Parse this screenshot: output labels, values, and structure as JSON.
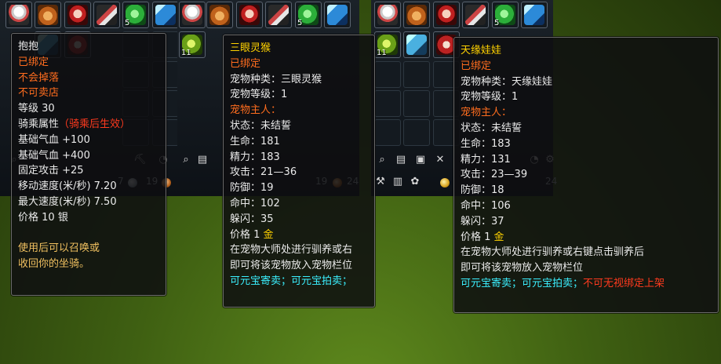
{
  "slot_counts": {
    "jade": "5",
    "leaf": "11"
  },
  "toolbar": {
    "silver_amount": "7",
    "copper_amount": "19",
    "copper_amount_2": "24"
  },
  "tooltips": [
    {
      "lines": [
        {
          "parts": [
            {
              "text": "抱抱",
              "color": "white"
            }
          ]
        },
        {
          "parts": [
            {
              "text": "已绑定",
              "color": "orange"
            }
          ]
        },
        {
          "parts": [
            {
              "text": "不会掉落",
              "color": "orange"
            }
          ]
        },
        {
          "parts": [
            {
              "text": "不可卖店",
              "color": "orange"
            }
          ]
        },
        {
          "parts": [
            {
              "text": "等级 30",
              "color": "white"
            }
          ]
        },
        {
          "parts": [
            {
              "text": "骑乘属性",
              "color": "white"
            },
            {
              "text": "（骑乘后生效）",
              "color": "red"
            }
          ]
        },
        {
          "parts": [
            {
              "text": "基础气血 +100",
              "color": "white"
            }
          ]
        },
        {
          "parts": [
            {
              "text": "基础气血 +400",
              "color": "white"
            }
          ]
        },
        {
          "parts": [
            {
              "text": "固定攻击 +25",
              "color": "white"
            }
          ]
        },
        {
          "parts": [
            {
              "text": "移动速度(米/秒) 7.20",
              "color": "white"
            }
          ]
        },
        {
          "parts": [
            {
              "text": "最大速度(米/秒) 7.50",
              "color": "white"
            }
          ]
        },
        {
          "parts": [
            {
              "text": "价格  10 ",
              "color": "white"
            },
            {
              "text": "银",
              "color": "white"
            }
          ]
        },
        {
          "parts": [
            {
              "text": "",
              "color": "white"
            }
          ]
        },
        {
          "parts": [
            {
              "text": "使用后可以召唤或",
              "color": "tan"
            }
          ]
        },
        {
          "parts": [
            {
              "text": "收回你的坐骑。",
              "color": "tan"
            }
          ]
        }
      ]
    },
    {
      "lines": [
        {
          "parts": [
            {
              "text": "三眼灵猴",
              "color": "yellow"
            }
          ]
        },
        {
          "parts": [
            {
              "text": "已绑定",
              "color": "orange"
            }
          ]
        },
        {
          "parts": [
            {
              "text": "宠物种类：三眼灵猴",
              "color": "white"
            }
          ]
        },
        {
          "parts": [
            {
              "text": "宠物等级：1",
              "color": "white"
            }
          ]
        },
        {
          "parts": [
            {
              "text": "宠物主人：",
              "color": "orange"
            }
          ]
        },
        {
          "parts": [
            {
              "text": "状态：未结誓",
              "color": "white"
            }
          ]
        },
        {
          "parts": [
            {
              "text": "生命：181",
              "color": "white"
            }
          ]
        },
        {
          "parts": [
            {
              "text": "精力：183",
              "color": "white"
            }
          ]
        },
        {
          "parts": [
            {
              "text": "攻击：21—36",
              "color": "white"
            }
          ]
        },
        {
          "parts": [
            {
              "text": "防御：19",
              "color": "white"
            }
          ]
        },
        {
          "parts": [
            {
              "text": "命中：102",
              "color": "white"
            }
          ]
        },
        {
          "parts": [
            {
              "text": "躲闪：35",
              "color": "white"
            }
          ]
        },
        {
          "parts": [
            {
              "text": "价格  1 ",
              "color": "white"
            },
            {
              "text": "金",
              "color": "gold"
            }
          ]
        },
        {
          "parts": [
            {
              "text": "在宠物大师处进行驯养或右",
              "color": "white"
            }
          ]
        },
        {
          "parts": [
            {
              "text": "即可将该宠物放入宠物栏位",
              "color": "white"
            }
          ]
        },
        {
          "parts": [
            {
              "text": "可元宝寄卖；可元宝拍卖；",
              "color": "cyan"
            }
          ]
        }
      ]
    },
    {
      "lines": [
        {
          "parts": [
            {
              "text": "天缘娃娃",
              "color": "yellow"
            }
          ]
        },
        {
          "parts": [
            {
              "text": "已绑定",
              "color": "orange"
            }
          ]
        },
        {
          "parts": [
            {
              "text": "宠物种类：天缘娃娃",
              "color": "white"
            }
          ]
        },
        {
          "parts": [
            {
              "text": "宠物等级：1",
              "color": "white"
            }
          ]
        },
        {
          "parts": [
            {
              "text": "宠物主人：",
              "color": "orange"
            }
          ]
        },
        {
          "parts": [
            {
              "text": "状态：未结誓",
              "color": "white"
            }
          ]
        },
        {
          "parts": [
            {
              "text": "生命：183",
              "color": "white"
            }
          ]
        },
        {
          "parts": [
            {
              "text": "精力：131",
              "color": "white"
            }
          ]
        },
        {
          "parts": [
            {
              "text": "攻击：23—39",
              "color": "white"
            }
          ]
        },
        {
          "parts": [
            {
              "text": "防御：18",
              "color": "white"
            }
          ]
        },
        {
          "parts": [
            {
              "text": "命中：106",
              "color": "white"
            }
          ]
        },
        {
          "parts": [
            {
              "text": "躲闪：37",
              "color": "white"
            }
          ]
        },
        {
          "parts": [
            {
              "text": "价格  1 ",
              "color": "white"
            },
            {
              "text": "金",
              "color": "gold"
            }
          ]
        },
        {
          "parts": [
            {
              "text": "在宠物大师处进行驯养或右键点击驯养后",
              "color": "white"
            }
          ]
        },
        {
          "parts": [
            {
              "text": "即可将该宠物放入宠物栏位",
              "color": "white"
            }
          ]
        },
        {
          "parts": [
            {
              "text": "可元宝寄卖；可元宝拍卖；",
              "color": "cyan"
            },
            {
              "text": "不可无视绑定上架",
              "color": "red"
            }
          ]
        }
      ]
    }
  ]
}
